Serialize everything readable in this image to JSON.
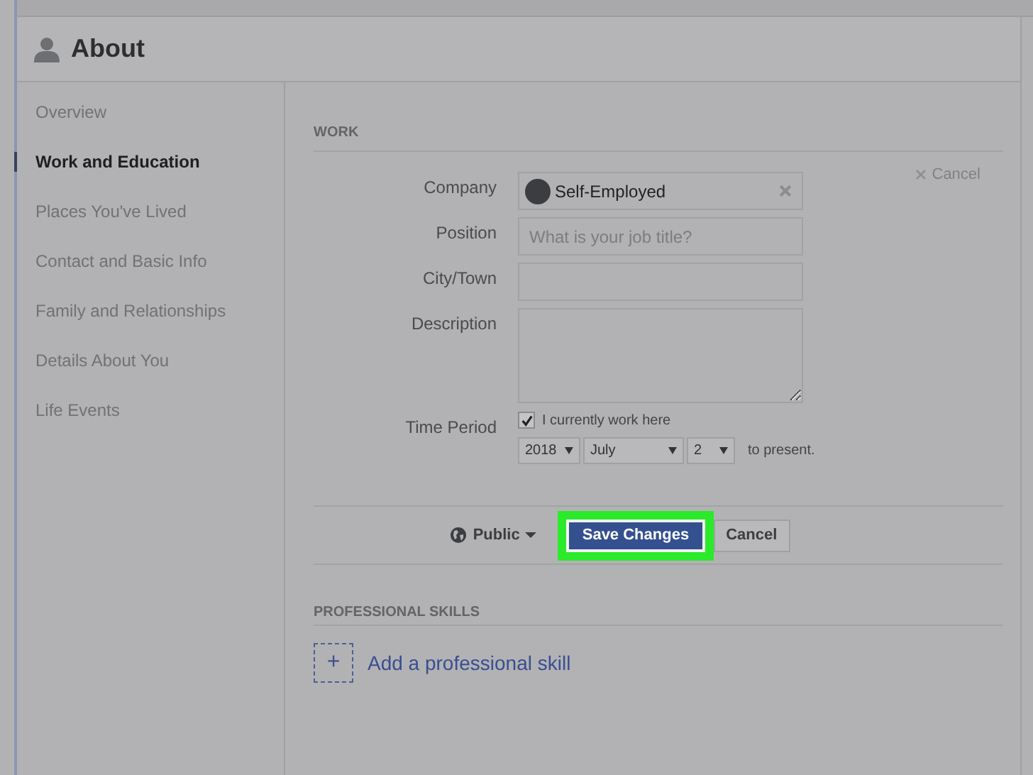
{
  "header": {
    "title": "About"
  },
  "sidebar": {
    "items": [
      {
        "label": "Overview",
        "selected": false
      },
      {
        "label": "Work and Education",
        "selected": true
      },
      {
        "label": "Places You've Lived",
        "selected": false
      },
      {
        "label": "Contact and Basic Info",
        "selected": false
      },
      {
        "label": "Family and Relationships",
        "selected": false
      },
      {
        "label": "Details About You",
        "selected": false
      },
      {
        "label": "Life Events",
        "selected": false
      }
    ]
  },
  "work": {
    "heading": "WORK",
    "cancel_link": "Cancel",
    "fields": [
      {
        "kind": "company",
        "label": "Company",
        "value": "Self-Employed"
      },
      {
        "kind": "text",
        "label": "Position",
        "placeholder": "What is your job title?"
      },
      {
        "kind": "text",
        "label": "City/Town"
      },
      {
        "kind": "textarea",
        "label": "Description"
      }
    ],
    "time_period": {
      "label": "Time Period",
      "checkbox_label": "I currently work here",
      "checked": true,
      "year": "2018",
      "month": "July",
      "day": "2",
      "suffix": "to present."
    },
    "audience": "Public",
    "save_button": "Save Changes",
    "cancel_button": "Cancel"
  },
  "professional_skills": {
    "heading": "PROFESSIONAL SKILLS",
    "add_link": "Add a professional skill",
    "add_icon": "+"
  }
}
